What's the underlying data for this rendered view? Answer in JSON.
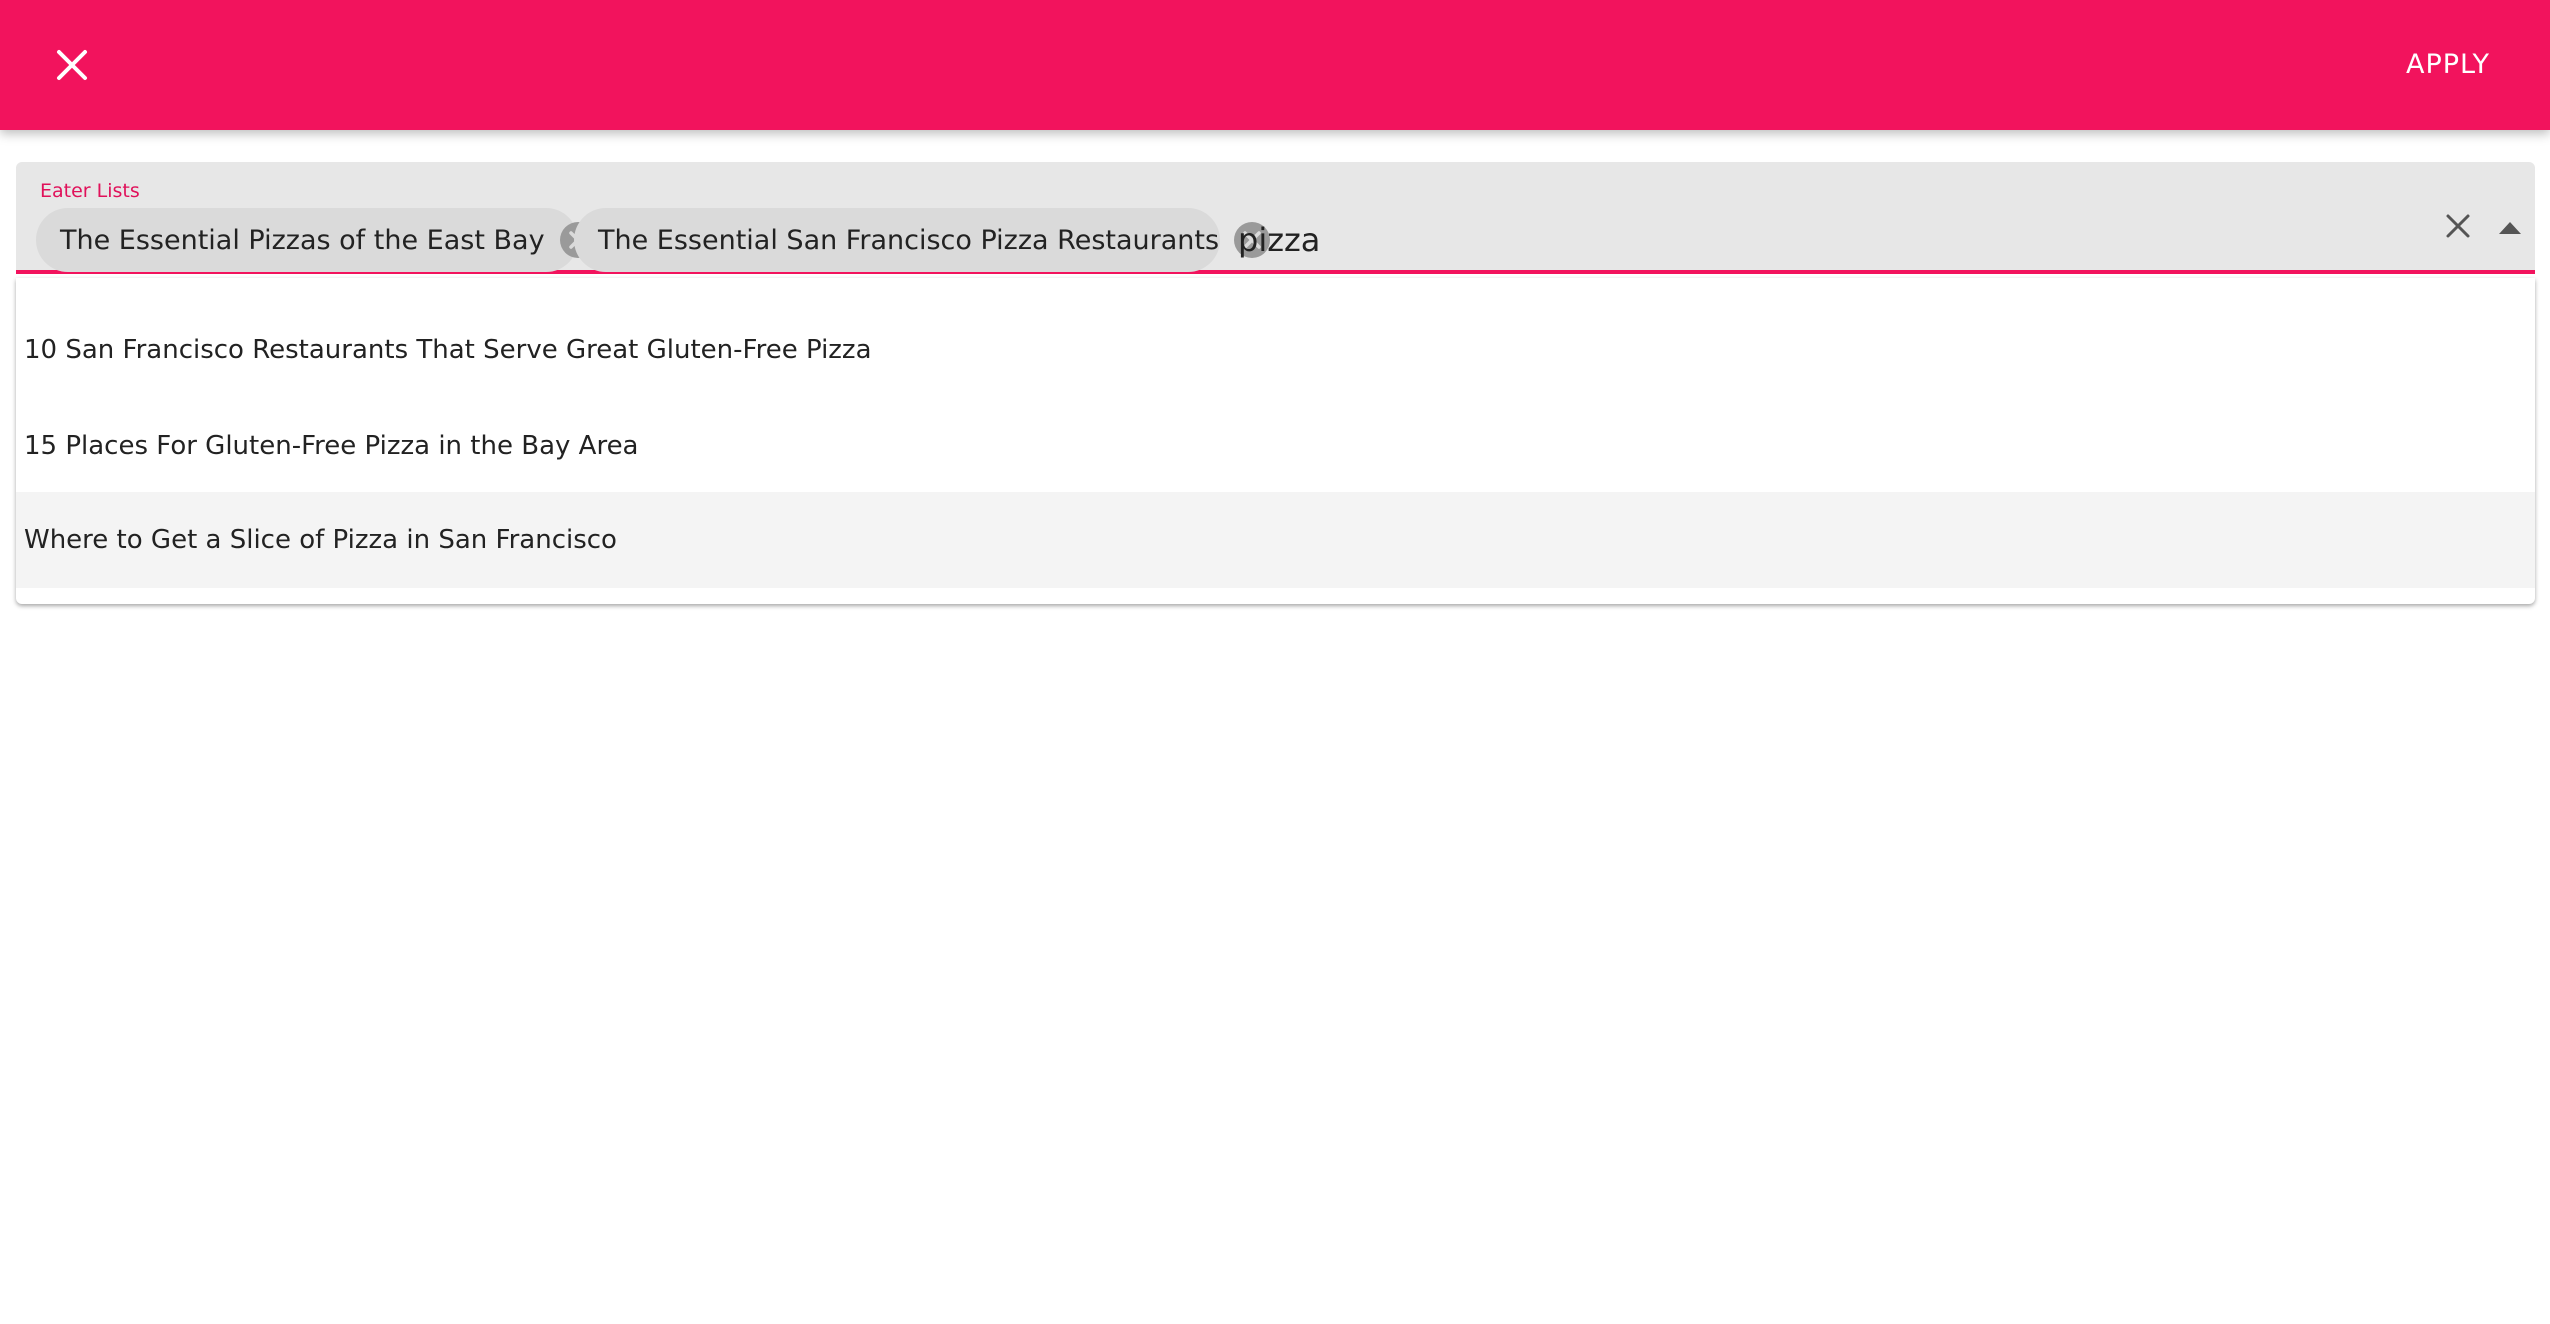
{
  "header": {
    "close_icon": "close-icon",
    "apply_label": "APPLY",
    "background_color": "#f2135d"
  },
  "field": {
    "label": "Eater Lists",
    "accent_color": "#f2135d",
    "chips": [
      {
        "label": "The Essential Pizzas of the East Bay",
        "remove_icon": "cancel-circle-icon"
      },
      {
        "label": "The Essential San Francisco Pizza Restaurants",
        "remove_icon": "cancel-circle-icon"
      }
    ],
    "query_value": "pizza",
    "clear_icon": "close-icon",
    "toggle_icon": "arrow-up-icon"
  },
  "dropdown": {
    "options": [
      {
        "label": "10 San Francisco Restaurants That Serve Great Gluten-Free Pizza"
      },
      {
        "label": "15 Places For Gluten-Free Pizza in the Bay Area"
      },
      {
        "label": "Where to Get a Slice of Pizza in San Francisco"
      }
    ]
  }
}
